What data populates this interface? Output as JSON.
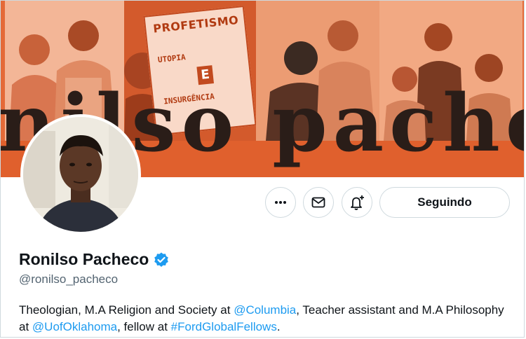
{
  "banner": {
    "name_text": "nilso pache",
    "book_title": "PROFETISMO",
    "book_line1": "UTOPIA",
    "book_e": "E",
    "book_line2": "INSURGÊNCIA"
  },
  "actions": {
    "more_icon": "more-horizontal-icon",
    "message_icon": "envelope-icon",
    "notify_icon": "bell-plus-icon",
    "following_label": "Seguindo"
  },
  "profile": {
    "display_name": "Ronilso Pacheco",
    "verified_icon": "verified-badge-icon",
    "handle": "@ronilso_pacheco",
    "bio": {
      "t1": "Theologian, M.A Religion and Society at ",
      "l1": "@Columbia",
      "t2": ", Teacher assistant and M.A Philosophy at ",
      "l2": "@UofOklahoma",
      "t3": ", fellow at ",
      "l3": "#FordGlobalFellows",
      "t4": "."
    }
  },
  "colors": {
    "banner_orange": "#e46a38",
    "link_blue": "#1d9bf0",
    "text_primary": "#0f1419",
    "text_secondary": "#536471",
    "border": "#cfd9de"
  }
}
